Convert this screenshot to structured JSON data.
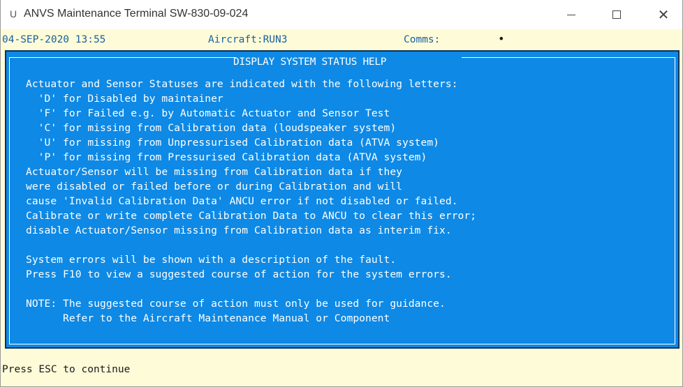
{
  "window": {
    "title": "ANVS Maintenance Terminal SW-830-09-024",
    "icon_glyph": "U",
    "min_icon": "minimize-icon",
    "max_icon": "maximize-icon",
    "close_glyph": "✕"
  },
  "status": {
    "date_time": "04-SEP-2020  13:55",
    "aircraft": "Aircraft:RUN3",
    "comms": "Comms:",
    "comms_indicator": "•"
  },
  "panel": {
    "title": "DISPLAY SYSTEM STATUS HELP",
    "lines": [
      "Actuator and Sensor Statuses are indicated with the following letters:",
      "  'D' for Disabled by maintainer",
      "  'F' for Failed e.g. by Automatic Actuator and Sensor Test",
      "  'C' for missing from Calibration data (loudspeaker system)",
      "  'U' for missing from Unpressurised Calibration data (ATVA system)",
      "  'P' for missing from Pressurised Calibration data (ATVA system)",
      "Actuator/Sensor will be missing from Calibration data if they",
      "were disabled or failed before or during Calibration and will",
      "cause 'Invalid Calibration Data' ANCU error if not disabled or failed.",
      "Calibrate or write complete Calibration Data to ANCU to clear this error;",
      "disable Actuator/Sensor missing from Calibration data as interim fix.",
      "",
      "System errors will be shown with a description of the fault.",
      "Press F10 to view a suggested course of action for the system errors.",
      "",
      "NOTE: The suggested course of action must only be used for guidance.",
      "      Refer to the Aircraft Maintenance Manual or Component"
    ]
  },
  "footer": {
    "prompt": "Press ESC to continue"
  }
}
